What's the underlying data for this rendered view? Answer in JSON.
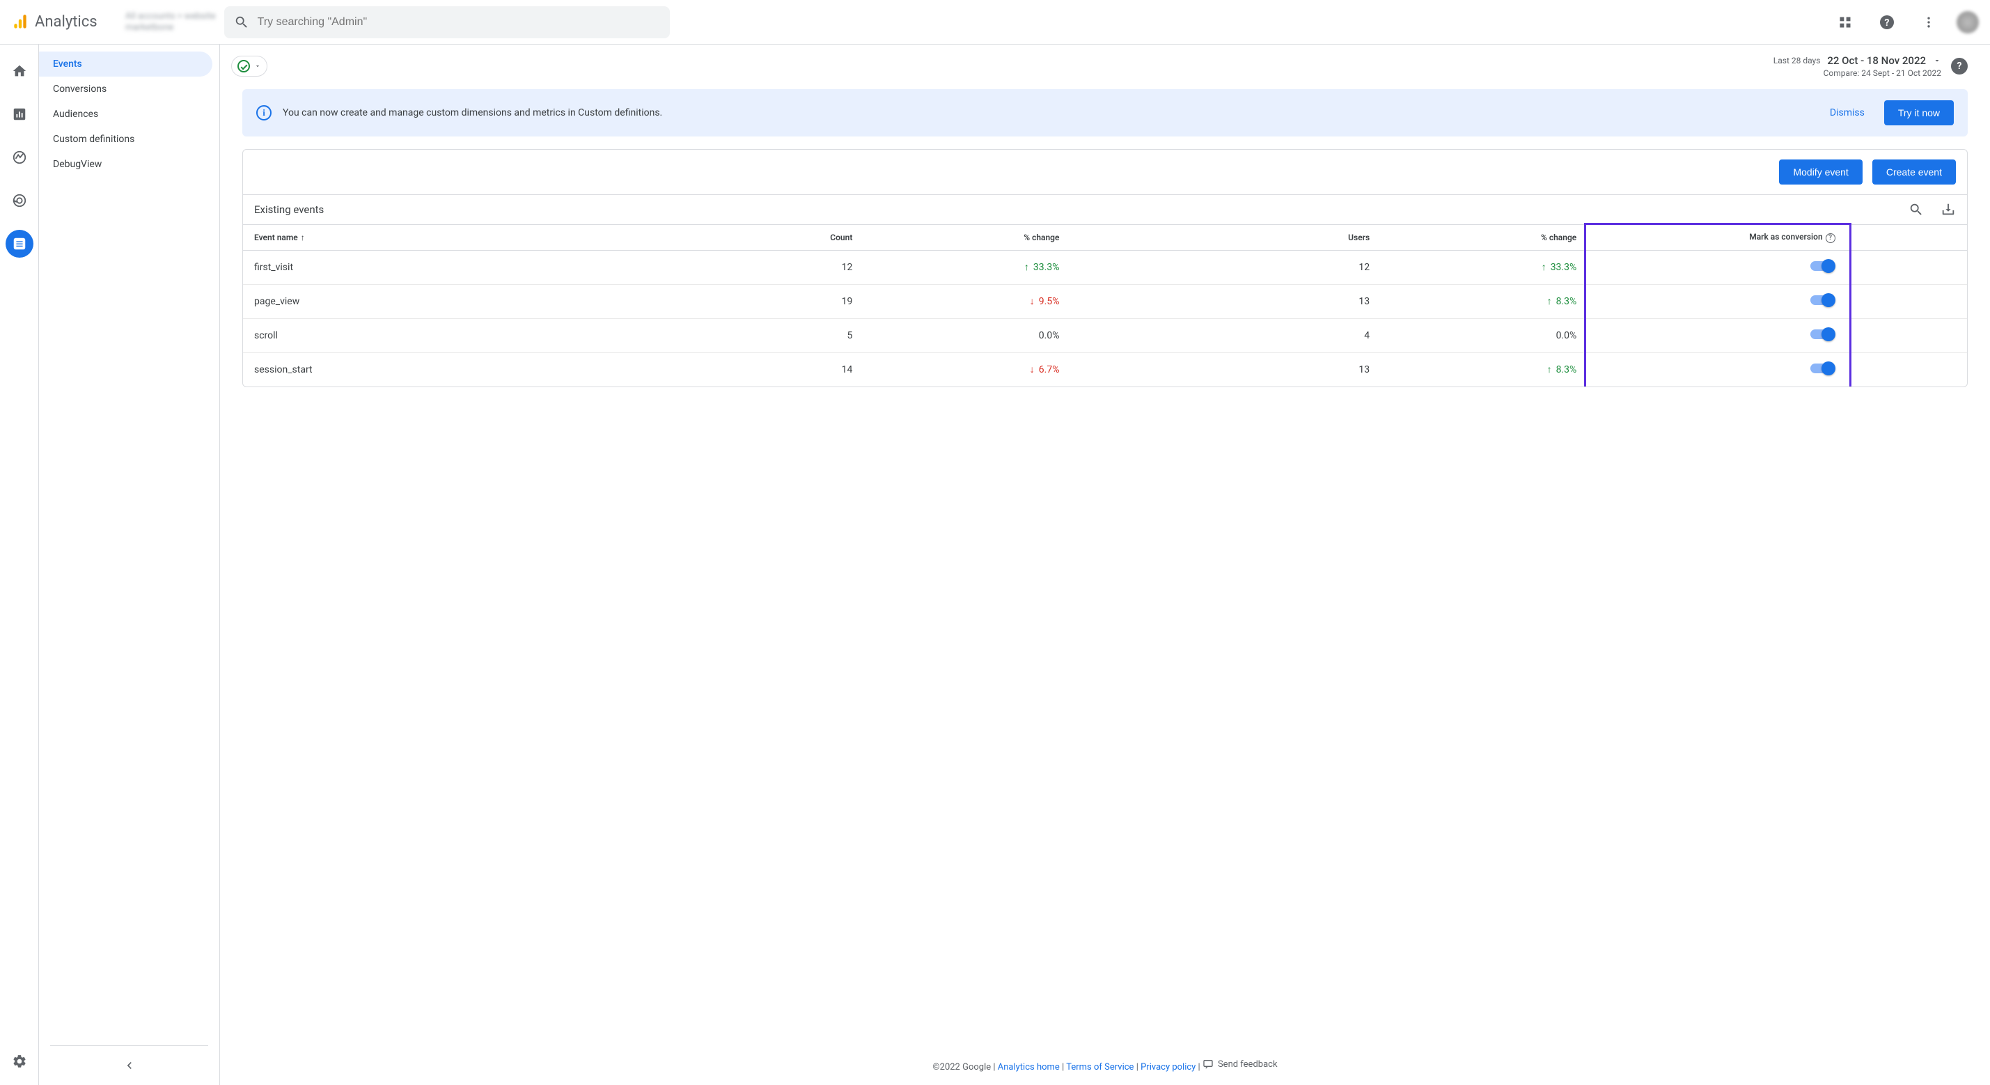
{
  "header": {
    "brand": "Analytics",
    "property_line1": "All accounts > website",
    "property_line2": "marketbone",
    "search_placeholder": "Try searching \"Admin\""
  },
  "subnav": {
    "items": [
      {
        "label": "Events",
        "active": true
      },
      {
        "label": "Conversions",
        "active": false
      },
      {
        "label": "Audiences",
        "active": false
      },
      {
        "label": "Custom definitions",
        "active": false
      },
      {
        "label": "DebugView",
        "active": false
      }
    ]
  },
  "date": {
    "label": "Last 28 days",
    "range": "22 Oct - 18 Nov 2022",
    "compare": "Compare: 24 Sept - 21 Oct 2022"
  },
  "banner": {
    "text": "You can now create and manage custom dimensions and metrics in Custom definitions.",
    "dismiss": "Dismiss",
    "cta": "Try it now"
  },
  "card": {
    "modify_label": "Modify event",
    "create_label": "Create event",
    "title": "Existing events",
    "columns": {
      "event_name": "Event name",
      "count": "Count",
      "change1": "% change",
      "users": "Users",
      "change2": "% change",
      "mark": "Mark as conversion"
    },
    "rows": [
      {
        "name": "first_visit",
        "count": "12",
        "change1": "33.3%",
        "dir1": "up",
        "users": "12",
        "change2": "33.3%",
        "dir2": "up",
        "on": true
      },
      {
        "name": "page_view",
        "count": "19",
        "change1": "9.5%",
        "dir1": "down",
        "users": "13",
        "change2": "8.3%",
        "dir2": "up",
        "on": true
      },
      {
        "name": "scroll",
        "count": "5",
        "change1": "0.0%",
        "dir1": "none",
        "users": "4",
        "change2": "0.0%",
        "dir2": "none",
        "on": true
      },
      {
        "name": "session_start",
        "count": "14",
        "change1": "6.7%",
        "dir1": "down",
        "users": "13",
        "change2": "8.3%",
        "dir2": "up",
        "on": true
      }
    ]
  },
  "footer": {
    "copyright": "©2022 Google",
    "links": [
      "Analytics home",
      "Terms of Service",
      "Privacy policy"
    ],
    "feedback": "Send feedback"
  }
}
